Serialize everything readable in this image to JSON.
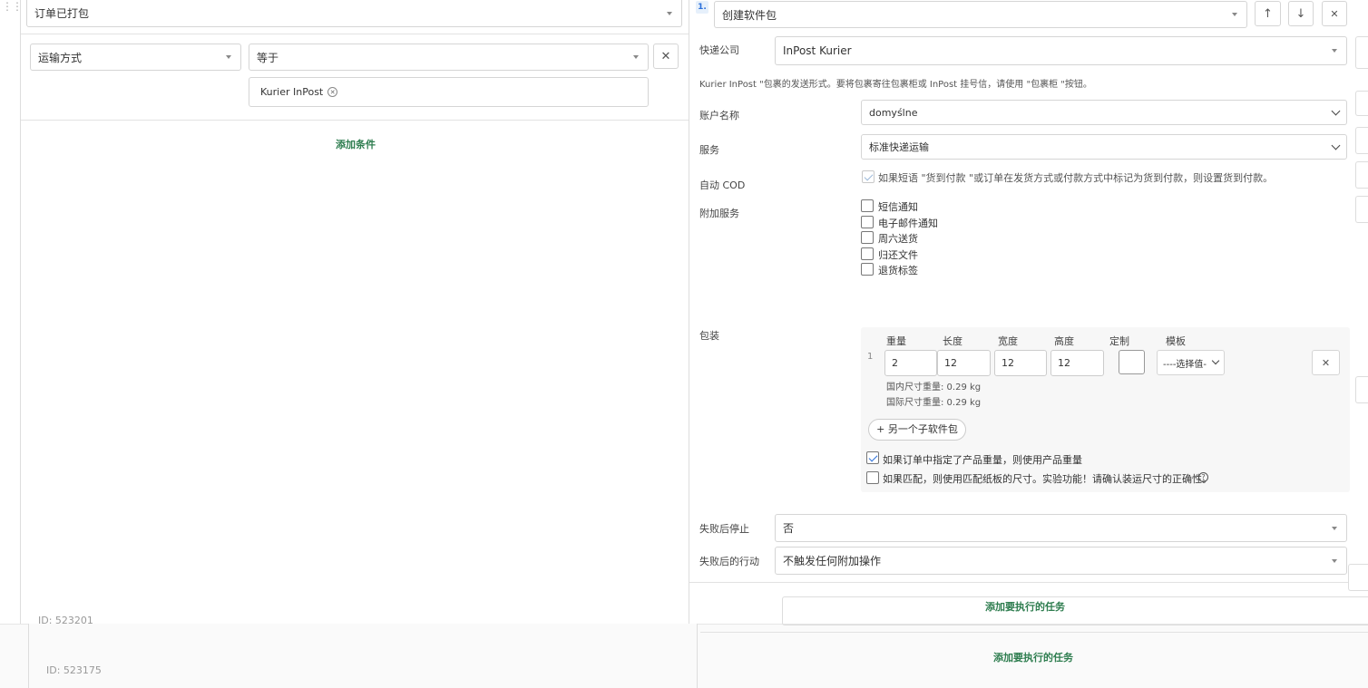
{
  "left": {
    "trigger_value": "订单已打包",
    "condition": {
      "field": "运输方式",
      "operator": "等于",
      "tags": [
        "Kurier InPost"
      ]
    },
    "add_condition_label": "添加条件",
    "id_label": "ID: 523201",
    "outer_id_label": "ID: 523175"
  },
  "right": {
    "step_number": "1.",
    "task_value": "创建软件包",
    "courier": {
      "label": "快递公司",
      "value": "InPost Kurier"
    },
    "courier_note": "Kurier InPost \"包裹的发送形式。要将包裹寄往包裹柜或 InPost 挂号信，请使用 \"包裹柜 \"按钮。",
    "account": {
      "label": "账户名称",
      "value": "domyślne"
    },
    "service": {
      "label": "服务",
      "value": "标准快递运输"
    },
    "auto_cod": {
      "label": "自动 COD",
      "text": "如果短语 \"货到付款 \"或订单在发货方式或付款方式中标记为货到付款，则设置货到付款。",
      "checked": true
    },
    "extra_services": {
      "label": "附加服务",
      "items": [
        "短信通知",
        "电子邮件通知",
        "周六送货",
        "归还文件",
        "退货标签"
      ]
    },
    "packaging": {
      "label": "包装",
      "row_index": "1",
      "headers": {
        "weight": "重量",
        "length": "长度",
        "width": "宽度",
        "height": "高度",
        "custom": "定制",
        "template": "模板"
      },
      "values": {
        "weight": "2",
        "length": "12",
        "width": "12",
        "height": "12"
      },
      "template_placeholder": "----选择值-",
      "domestic_dim_weight": "国内尺寸重量: 0.29 kg",
      "intl_dim_weight": "国际尺寸重量: 0.29 kg",
      "add_subpackage_label": "+ 另一个子软件包",
      "use_product_weight": {
        "text": "如果订单中指定了产品重量，则使用产品重量",
        "checked": true
      },
      "use_template_dims": {
        "text": "如果匹配，则使用匹配纸板的尺寸。实验功能！请确认装运尺寸的正确性。",
        "checked": false
      }
    },
    "stop_on_fail": {
      "label": "失败后停止",
      "value": "否"
    },
    "action_on_fail": {
      "label": "失败后的行动",
      "value": "不触发任何附加操作"
    },
    "add_task_label": "添加要执行的任务",
    "outer_add_task_label": "添加要执行的任务"
  },
  "colors": {
    "accent_green": "#2e7d4f",
    "step_badge": "#2a6fdb"
  }
}
